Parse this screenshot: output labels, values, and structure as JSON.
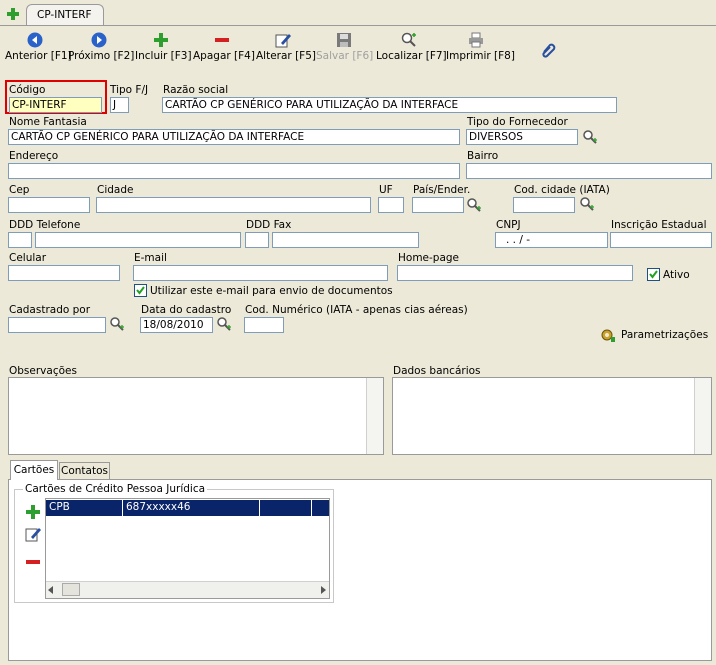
{
  "window": {
    "tab_title": "CP-INTERF"
  },
  "toolbar": {
    "anterior": "Anterior [F1]",
    "proximo": "Próximo [F2]",
    "incluir": "Incluir [F3]",
    "apagar": "Apagar [F4]",
    "alterar": "Alterar [F5]",
    "salvar": "Salvar [F6]",
    "localizar": "Localizar [F7]",
    "imprimir": "Imprimir [F8]"
  },
  "form": {
    "codigo_label": "Código",
    "codigo_value": "CP-INTERF",
    "tipo_label": "Tipo F/J",
    "tipo_value": "J",
    "razao_label": "Razão social",
    "razao_value": "CARTÃO CP GENÉRICO PARA UTILIZAÇÃO DA INTERFACE",
    "fantasia_label": "Nome Fantasia",
    "fantasia_value": "CARTÃO CP GENÉRICO PARA UTILIZAÇÃO DA INTERFACE",
    "tipo_fornecedor_label": "Tipo do Fornecedor",
    "tipo_fornecedor_value": "DIVERSOS",
    "endereco_label": "Endereço",
    "bairro_label": "Bairro",
    "cep_label": "Cep",
    "cidade_label": "Cidade",
    "uf_label": "UF",
    "pais_label": "País/Ender.",
    "cod_cidade_label": "Cod. cidade (IATA)",
    "ddd_tel_label": "DDD Telefone",
    "ddd_fax_label": "DDD Fax",
    "cnpj_label": "CNPJ",
    "cnpj_value": ".   .    /    -",
    "insc_label": "Inscrição Estadual",
    "celular_label": "Celular",
    "email_label": "E-mail",
    "homepage_label": "Home-page",
    "ativo_label": "Ativo",
    "utilizar_email_label": "Utilizar este e-mail para envio de documentos",
    "cadastrado_label": "Cadastrado por",
    "data_cadastro_label": "Data do cadastro",
    "data_cadastro_value": "18/08/2010",
    "cod_numerico_label": "Cod. Numérico (IATA - apenas cias aéreas)",
    "parametrizacoes_label": "Parametrizações",
    "observacoes_label": "Observações",
    "dados_bancarios_label": "Dados bancários"
  },
  "tabs": {
    "cartoes": "Cartões",
    "contatos": "Contatos"
  },
  "cards": {
    "group_title": "Cartões de Crédito Pessoa Jurídica",
    "rows": [
      {
        "code": "CPB",
        "number": "687xxxxx46"
      }
    ]
  },
  "colors": {
    "highlight_border": "#e00000",
    "selection": "#0a246a",
    "field_focus": "#ffffc0"
  }
}
